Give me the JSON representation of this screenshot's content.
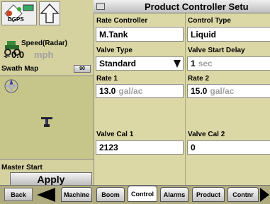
{
  "status": {
    "gps_label": "DGPS",
    "speed_label": "Speed(Radar)",
    "speed_value": "0.0",
    "speed_unit": "mph"
  },
  "swath": {
    "title": "Swath Map",
    "zoom": "90"
  },
  "master": {
    "label": "Master Start",
    "button": "Apply"
  },
  "page": {
    "title": "Product Controller Setu"
  },
  "fields": {
    "rate_controller": {
      "label": "Rate Controller",
      "value": "M.Tank"
    },
    "control_type": {
      "label": "Control Type",
      "value": "Liquid"
    },
    "valve_type": {
      "label": "Valve Type",
      "value": "Standard"
    },
    "valve_start_delay": {
      "label": "Valve Start Delay",
      "value": "1",
      "unit": "sec"
    },
    "rate1": {
      "label": "Rate 1",
      "value": "13.0",
      "unit": "gal/ac"
    },
    "rate2": {
      "label": "Rate 2",
      "value": "15.0",
      "unit": "gal/ac"
    },
    "valve_cal1": {
      "label": "Valve Cal 1",
      "value": "2123"
    },
    "valve_cal2": {
      "label": "Valve Cal 2",
      "value": "0"
    }
  },
  "nav": {
    "back": "Back",
    "tabs": [
      "Machine",
      "Boom",
      "Control",
      "Alarms",
      "Product",
      "Contnr"
    ],
    "active_tab": "Control"
  },
  "colors": {
    "panel": "#d6d2a0",
    "map": "#c6c68a",
    "field_bg": "#ffffff",
    "unit_text": "#a0a0a0"
  }
}
